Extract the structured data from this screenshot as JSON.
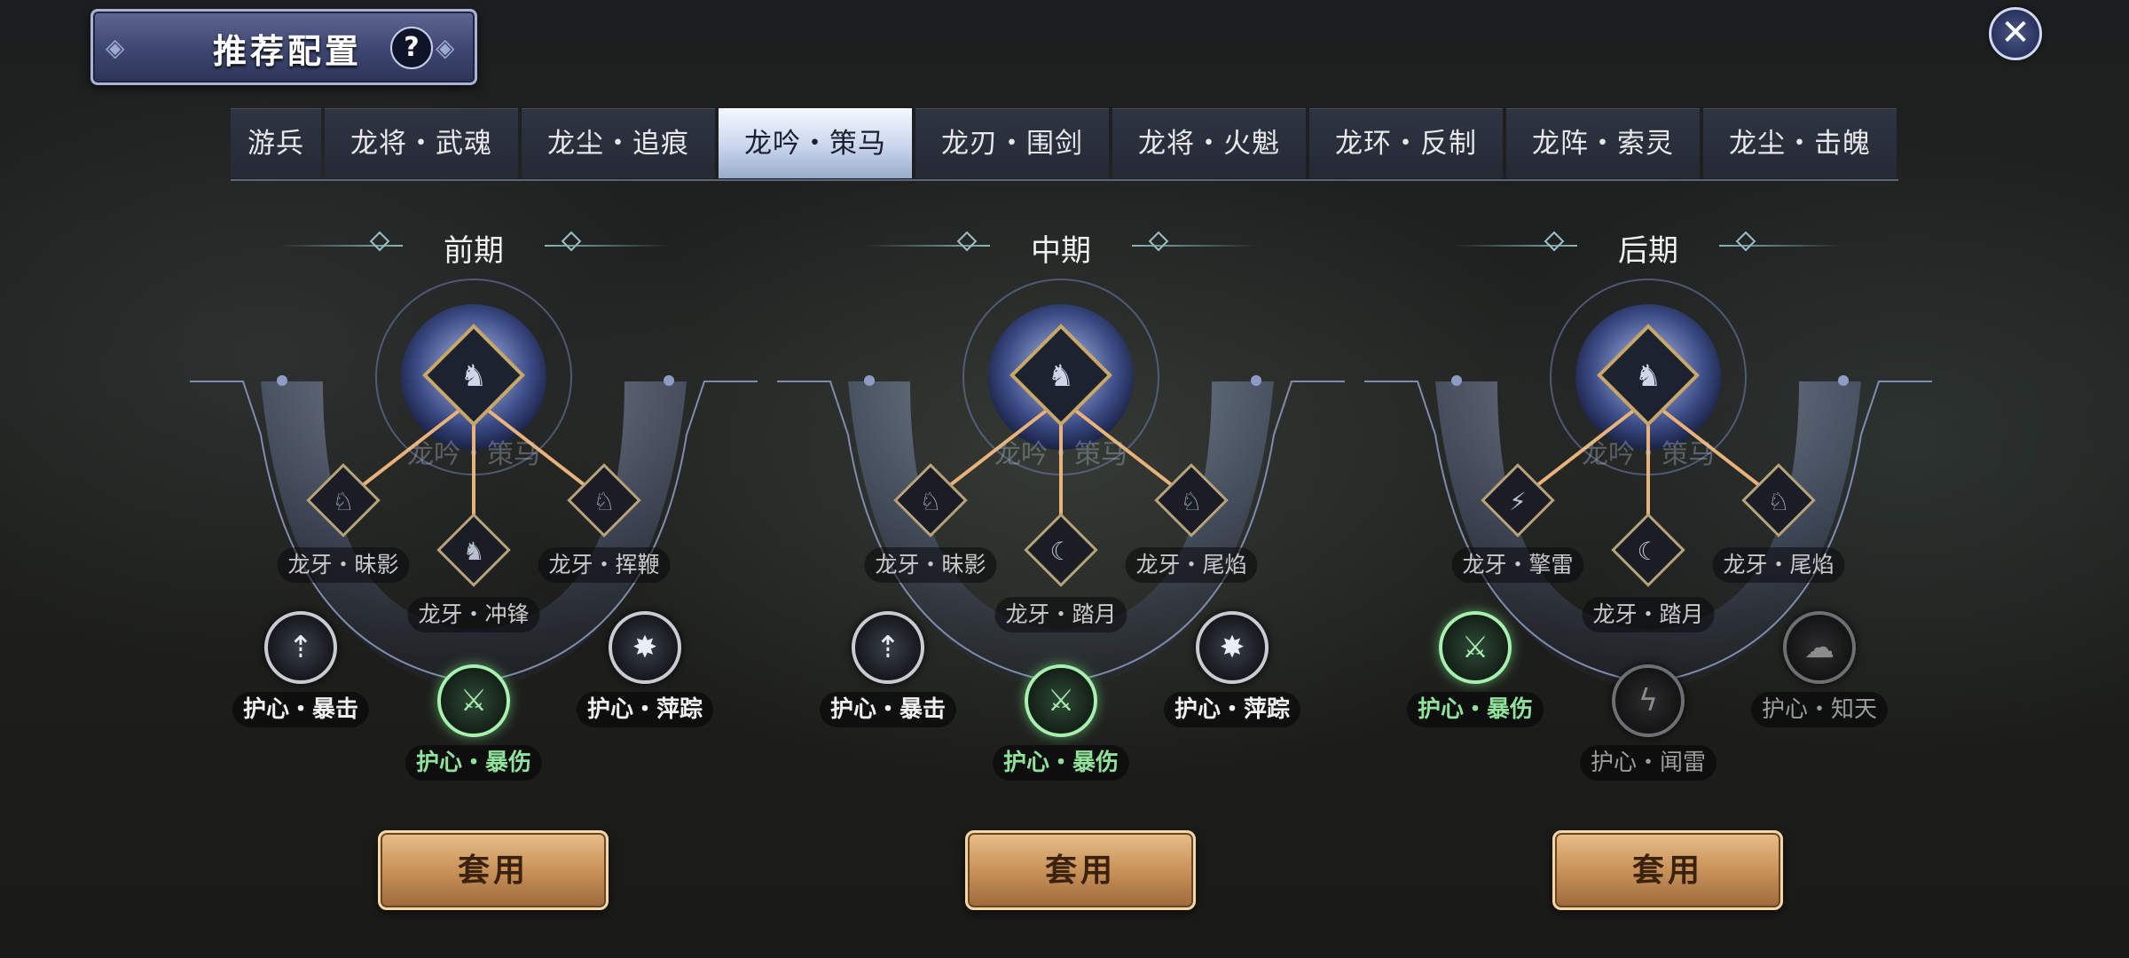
{
  "header": {
    "title": "推荐配置",
    "help_glyph": "?",
    "close_glyph": "✕"
  },
  "tabs": [
    {
      "label": "游兵",
      "active": false
    },
    {
      "label": "龙将・武魂",
      "active": false
    },
    {
      "label": "龙尘・追痕",
      "active": false
    },
    {
      "label": "龙吟・策马",
      "active": true
    },
    {
      "label": "龙刃・围剑",
      "active": false
    },
    {
      "label": "龙将・火魁",
      "active": false
    },
    {
      "label": "龙环・反制",
      "active": false
    },
    {
      "label": "龙阵・索灵",
      "active": false
    },
    {
      "label": "龙尘・击魄",
      "active": false
    }
  ],
  "colors": {
    "accent_green": "#8fe39a",
    "button_gold": "#c9925a",
    "tab_active": "#cdd9ef",
    "line_gold": "#e8b27a"
  },
  "sections": [
    {
      "phase": "前期",
      "core": "龙吟・策马",
      "fangs": {
        "left": "龙牙・昧影",
        "right": "龙牙・挥鞭",
        "center": "龙牙・冲锋"
      },
      "hearts": [
        {
          "label": "护心・暴击",
          "state": "normal",
          "icon": "crit-icon"
        },
        {
          "label": "护心・暴伤",
          "state": "selected",
          "icon": "crit-damage-icon"
        },
        {
          "label": "护心・萍踪",
          "state": "normal",
          "icon": "dodge-icon"
        }
      ],
      "apply_label": "套用"
    },
    {
      "phase": "中期",
      "core": "龙吟・策马",
      "fangs": {
        "left": "龙牙・昧影",
        "right": "龙牙・尾焰",
        "center": "龙牙・踏月"
      },
      "hearts": [
        {
          "label": "护心・暴击",
          "state": "normal",
          "icon": "crit-icon"
        },
        {
          "label": "护心・暴伤",
          "state": "selected",
          "icon": "crit-damage-icon"
        },
        {
          "label": "护心・萍踪",
          "state": "normal",
          "icon": "dodge-icon"
        }
      ],
      "apply_label": "套用"
    },
    {
      "phase": "后期",
      "core": "龙吟・策马",
      "fangs": {
        "left": "龙牙・擎雷",
        "right": "龙牙・尾焰",
        "center": "龙牙・踏月"
      },
      "hearts": [
        {
          "label": "护心・暴伤",
          "state": "selected",
          "icon": "crit-damage-icon"
        },
        {
          "label": "护心・闻雷",
          "state": "dim",
          "icon": "thunder-icon"
        },
        {
          "label": "护心・知天",
          "state": "dim",
          "icon": "cloud-icon"
        }
      ],
      "apply_label": "套用"
    }
  ]
}
